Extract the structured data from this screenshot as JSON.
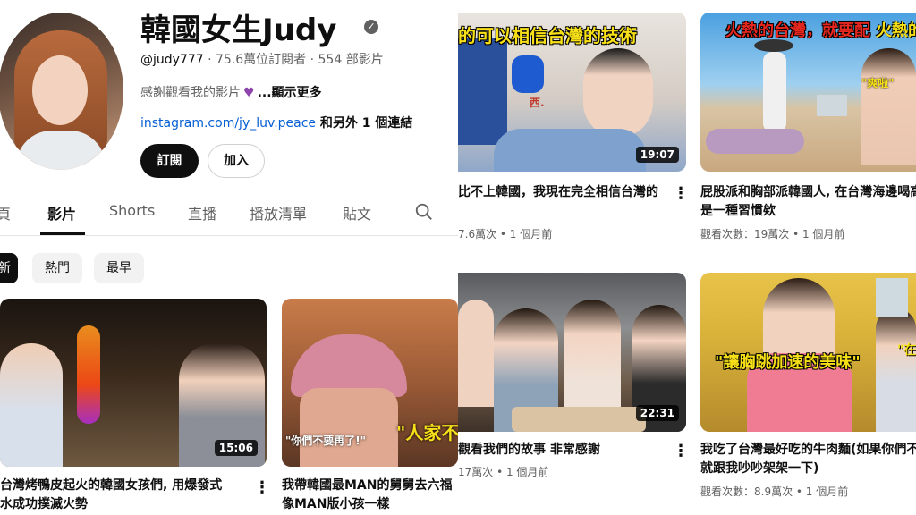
{
  "channel": {
    "name": "韓國女生Judy",
    "handle": "@judy777",
    "stats": " · 75.6萬位訂閱者 · 554 部影片",
    "desc_text": "感謝觀看我的影片",
    "desc_more": "...顯示更多",
    "link_url": "instagram.com/jy_luv.peace",
    "link_rest": " 和另外 1 個連結",
    "subscribe_label": "訂閱",
    "join_label": "加入"
  },
  "tabs": {
    "home_partial": "頁",
    "videos": "影片",
    "shorts": "Shorts",
    "live": "直播",
    "playlists": "播放清單",
    "posts": "貼文"
  },
  "chips": {
    "latest_partial": "新",
    "popular": "熱門",
    "oldest": "最早"
  },
  "left_videos": [
    {
      "title_line1": "台灣烤鴨皮起火的韓國女孩們, 用爆發式",
      "title_line2": "水成功撲滅火勢",
      "duration": "15:06"
    },
    {
      "title_line1": "我帶韓國最MAN的舅舅去六福",
      "title_line2": "像MAN版小孩一樣",
      "overlay_left": "\"你們不要再了!\"",
      "overlay_right": "\"人家不"
    }
  ],
  "right_videos": [
    {
      "overlay": "的可以相信台灣的技術",
      "sign": "西.",
      "duration": "19:07",
      "title": "比不上韓國，我現在完全相信台灣的",
      "meta": "7.6萬次 • 1 個月前"
    },
    {
      "overlay_a": "火熱的台灣，就要配",
      "overlay_b": "火熱的",
      "bubble": "\"爽啦\"",
      "title_line1": "屁股派和胸部派韓國人, 在台灣海邊喝高",
      "title_line2": "是一種習慣欸",
      "meta": "觀看次數：19萬次 • 1 個月前"
    },
    {
      "duration": "22:31",
      "title": "觀看我們的故事 非常感謝",
      "meta": "17萬次 • 1 個月前"
    },
    {
      "overlay": "\"讓胸跳加速的美味\"",
      "overlay_right": "\"在",
      "title_line1": "我吃了台灣最好吃的牛肉麵(如果你們不",
      "title_line2": "就跟我吵吵架架一下)",
      "meta": "觀看次數：8.9萬次 • 1 個月前"
    }
  ],
  "colors": {
    "link": "#065fd4",
    "meta_gray": "#606060",
    "overlay_yellow": "#f7e017",
    "overlay_red": "#e8271f"
  }
}
